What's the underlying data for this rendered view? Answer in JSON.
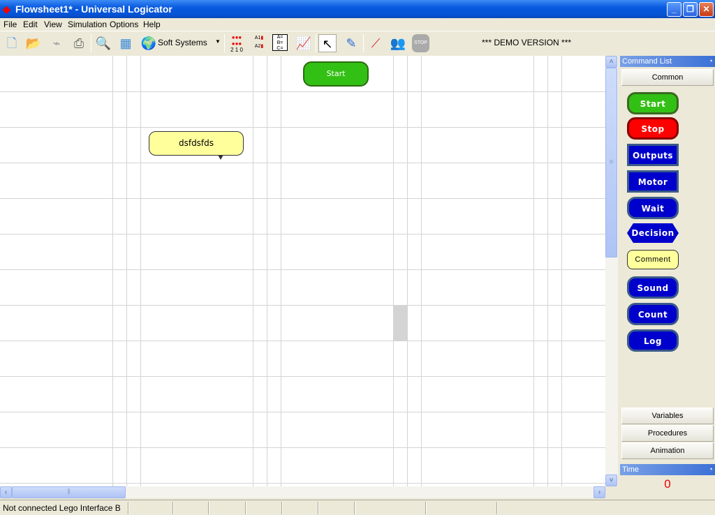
{
  "window": {
    "title": "Flowsheet1* - Universal Logicator"
  },
  "menu": [
    "File",
    "Edit",
    "View",
    "Simulation",
    "Options",
    "Help"
  ],
  "toolbar": {
    "combo_value": "Soft Systems",
    "demo_label": "*** DEMO VERSION ***",
    "icons": [
      "new-file-icon",
      "open-folder-icon",
      "usb-icon",
      "print-icon",
      "search-icon",
      "grid-icon",
      "globe-icon",
      "led-panel-icon",
      "analog-icon",
      "variables-icon",
      "graph-icon",
      "pointer-icon",
      "pencil-icon",
      "connect-icon",
      "users-icon",
      "stop-icon"
    ],
    "led_digits": "2 1 0",
    "analog_labels": [
      "A1",
      "A2"
    ],
    "abc_label": "A=\nB=\nC="
  },
  "canvas": {
    "blocks": [
      {
        "type": "start",
        "label": "Start",
        "color": "#33c014"
      },
      {
        "type": "comment",
        "label": "dsfdsfds",
        "color": "#ffff9c"
      }
    ]
  },
  "panel": {
    "title": "Command List",
    "active_tab": "Common",
    "commands": [
      {
        "label": "Start",
        "color": "#33c014",
        "shape": "rounded"
      },
      {
        "label": "Stop",
        "color": "#ff0000",
        "shape": "rounded"
      },
      {
        "label": "Outputs",
        "color": "#0000cc",
        "shape": "rect"
      },
      {
        "label": "Motor",
        "color": "#0000cc",
        "shape": "rect"
      },
      {
        "label": "Wait",
        "color": "#0000cc",
        "shape": "rounded"
      },
      {
        "label": "Decision",
        "color": "#0000cc",
        "shape": "diamond"
      },
      {
        "label": "Comment",
        "color": "#ffff9c",
        "shape": "comment"
      },
      {
        "label": "Sound",
        "color": "#0000cc",
        "shape": "rounded"
      },
      {
        "label": "Count",
        "color": "#0000cc",
        "shape": "rounded"
      },
      {
        "label": "Log",
        "color": "#0000cc",
        "shape": "rounded"
      }
    ],
    "tabs": [
      "Variables",
      "Procedures",
      "Animation"
    ],
    "time_title": "Time",
    "time_value": "0"
  },
  "status": {
    "text": "Not connected Lego Interface B"
  }
}
